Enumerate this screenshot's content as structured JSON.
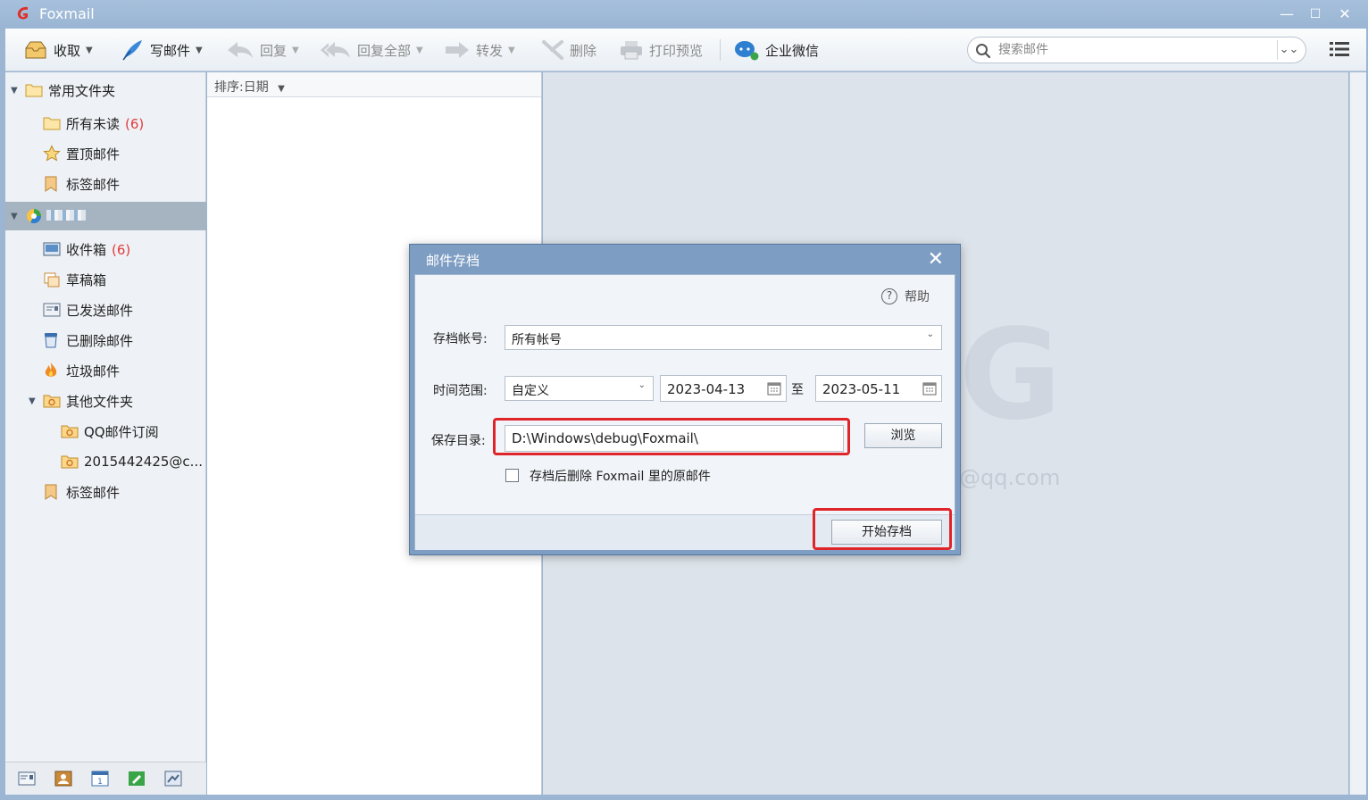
{
  "window": {
    "title": "Foxmail",
    "minimize": "—",
    "maximize": "☐",
    "close": "✕"
  },
  "toolbar": {
    "receive": "收取",
    "compose": "写邮件",
    "reply": "回复",
    "reply_all": "回复全部",
    "forward": "转发",
    "delete": "删除",
    "print_preview": "打印预览",
    "wecom": "企业微信",
    "search_placeholder": "搜索邮件"
  },
  "folders": {
    "common": "常用文件夹",
    "all_unread": "所有未读",
    "all_unread_count": "(6)",
    "pinned": "置顶邮件",
    "tagged": "标签邮件",
    "inbox": "收件箱",
    "inbox_count": "(6)",
    "drafts": "草稿箱",
    "sent": "已发送邮件",
    "deleted": "已删除邮件",
    "junk": "垃圾邮件",
    "other": "其他文件夹",
    "qq_sub": "QQ邮件订阅",
    "account2": "2015442425@c...",
    "tagged2": "标签邮件"
  },
  "list": {
    "sort_label": "排序:日期"
  },
  "reader": {
    "watermark_text": "@qq.com"
  },
  "dialog": {
    "title": "邮件存档",
    "close": "✕",
    "help": "帮助",
    "account_label": "存档帐号:",
    "account_value": "所有帐号",
    "range_label": "时间范围:",
    "range_value": "自定义",
    "date_from": "2023-04-13",
    "to_label": "至",
    "date_to": "2023-05-11",
    "dir_label": "保存目录:",
    "dir_value": "D:\\Windows\\debug\\Foxmail\\",
    "browse": "浏览",
    "delete_after": "存档后删除 Foxmail 里的原邮件",
    "delete_after_checked": false,
    "start": "开始存档"
  },
  "colors": {
    "highlight_red": "#e0252a",
    "unread_count": "#e23b3b",
    "title_bar": "#9bb5d2"
  }
}
